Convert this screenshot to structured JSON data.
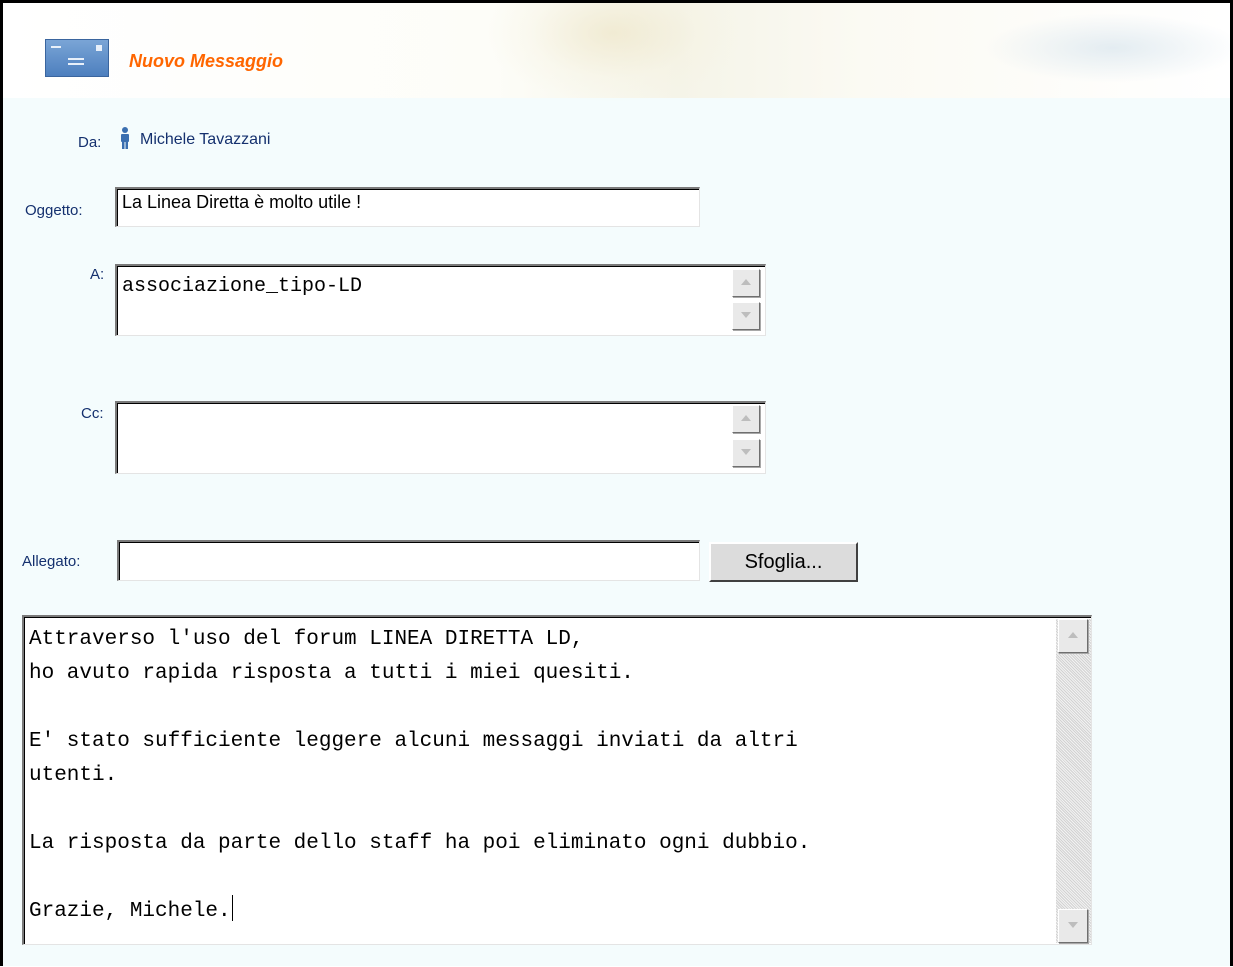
{
  "header": {
    "title": "Nuovo Messaggio"
  },
  "from": {
    "label": "Da:",
    "name": "Michele Tavazzani"
  },
  "subject": {
    "label": "Oggetto:",
    "value": "La Linea Diretta è molto utile !"
  },
  "to": {
    "label": "A:",
    "value": "associazione_tipo-LD"
  },
  "cc": {
    "label": "Cc:",
    "value": ""
  },
  "attachment": {
    "label": "Allegato:",
    "value": "",
    "browse_label": "Sfoglia..."
  },
  "body": {
    "lines": [
      "Attraverso l'uso del forum LINEA DIRETTA LD,",
      "ho avuto rapida risposta a tutti i miei quesiti.",
      "",
      "E' stato sufficiente leggere alcuni messaggi inviati da altri",
      "utenti.",
      "",
      "La risposta da parte dello staff ha poi eliminato ogni dubbio.",
      "",
      "Grazie, Michele."
    ]
  },
  "colors": {
    "title": "#ff6600",
    "labels": "#14306e",
    "panel_background": "#f4fcfd"
  },
  "icons": {
    "header": "envelope-icon",
    "sender": "person-icon",
    "scroll_up": "arrow-up-icon",
    "scroll_down": "arrow-down-icon"
  }
}
